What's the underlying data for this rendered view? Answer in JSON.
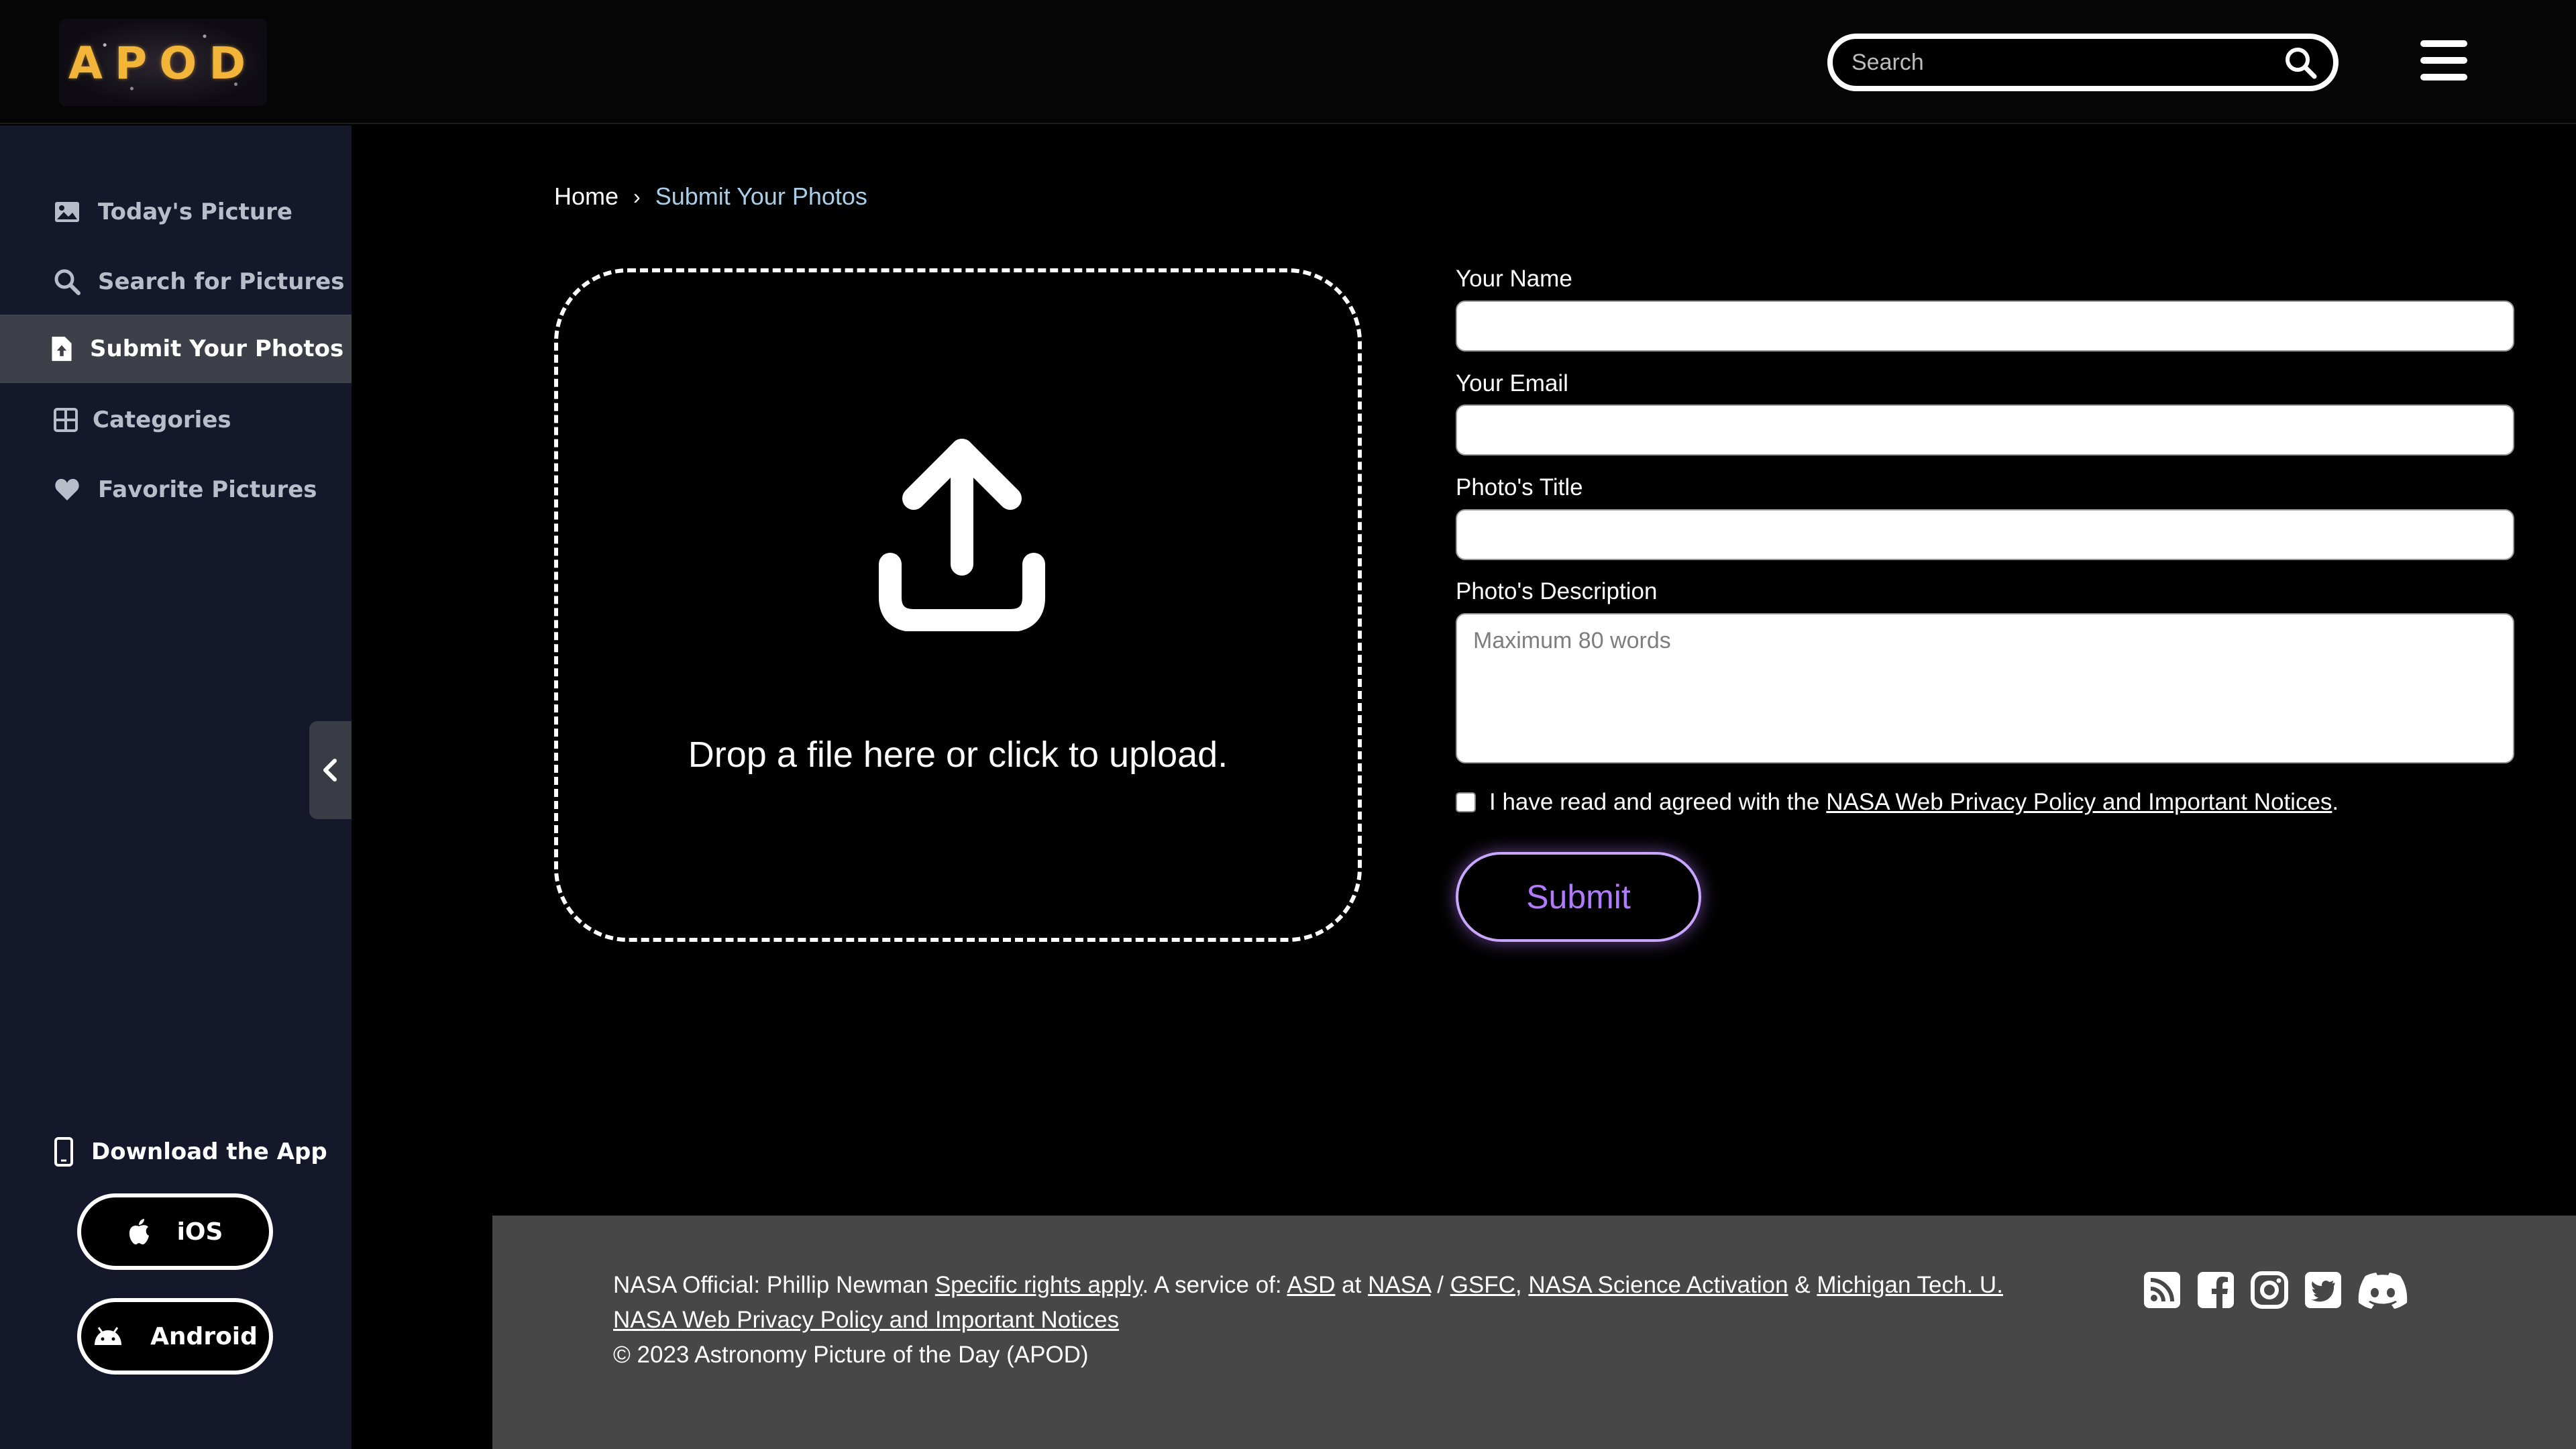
{
  "header": {
    "logo_text": "APOD",
    "search_placeholder": "Search"
  },
  "sidebar": {
    "items": [
      {
        "label": "Today's Picture",
        "icon": "image-icon"
      },
      {
        "label": "Search for Pictures",
        "icon": "search-icon"
      },
      {
        "label": "Submit Your Photos",
        "icon": "file-upload-icon",
        "active": true
      },
      {
        "label": "Categories",
        "icon": "grid-icon"
      },
      {
        "label": "Favorite Pictures",
        "icon": "heart-icon"
      }
    ],
    "download_title": "Download the App",
    "ios_label": "iOS",
    "android_label": "Android"
  },
  "breadcrumb": {
    "home": "Home",
    "separator": "›",
    "current": "Submit Your Photos"
  },
  "upload": {
    "drop_text": "Drop a file here or click to upload."
  },
  "form": {
    "name_label": "Your Name",
    "email_label": "Your Email",
    "title_label": "Photo's Title",
    "description_label": "Photo's Description",
    "description_placeholder": "Maximum 80 words",
    "agree_text": "I have read and agreed with the",
    "agree_link": "NASA Web Privacy Policy and Important Notices",
    "agree_end": ".",
    "submit_label": "Submit"
  },
  "footer": {
    "official_prefix": "NASA Official: Phillip Newman",
    "rights_link": "Specific rights apply",
    "service_prefix": ". A service of:",
    "asd_link": "ASD",
    "at_text": "at",
    "nasa_link": "NASA",
    "slash_text": "/",
    "gsfc_link": "GSFC",
    "comma_text": ",",
    "science_link": "NASA Science Activation",
    "amp_text": "&",
    "michigan_link": "Michigan Tech. U.",
    "privacy_link": "NASA Web Privacy Policy and Important Notices",
    "copyright": "© 2023 Astronomy Picture of the Day (APOD)",
    "socials": [
      "rss-icon",
      "facebook-icon",
      "instagram-icon",
      "twitter-icon",
      "discord-icon"
    ]
  },
  "colors": {
    "sidebar_bg": "#15182a",
    "active_item_bg": "#3d4049",
    "breadcrumb_current": "#a9cfe8",
    "submit_accent": "#b07cff",
    "footer_bg": "#474747",
    "logo_gold": "#f2b53a"
  }
}
